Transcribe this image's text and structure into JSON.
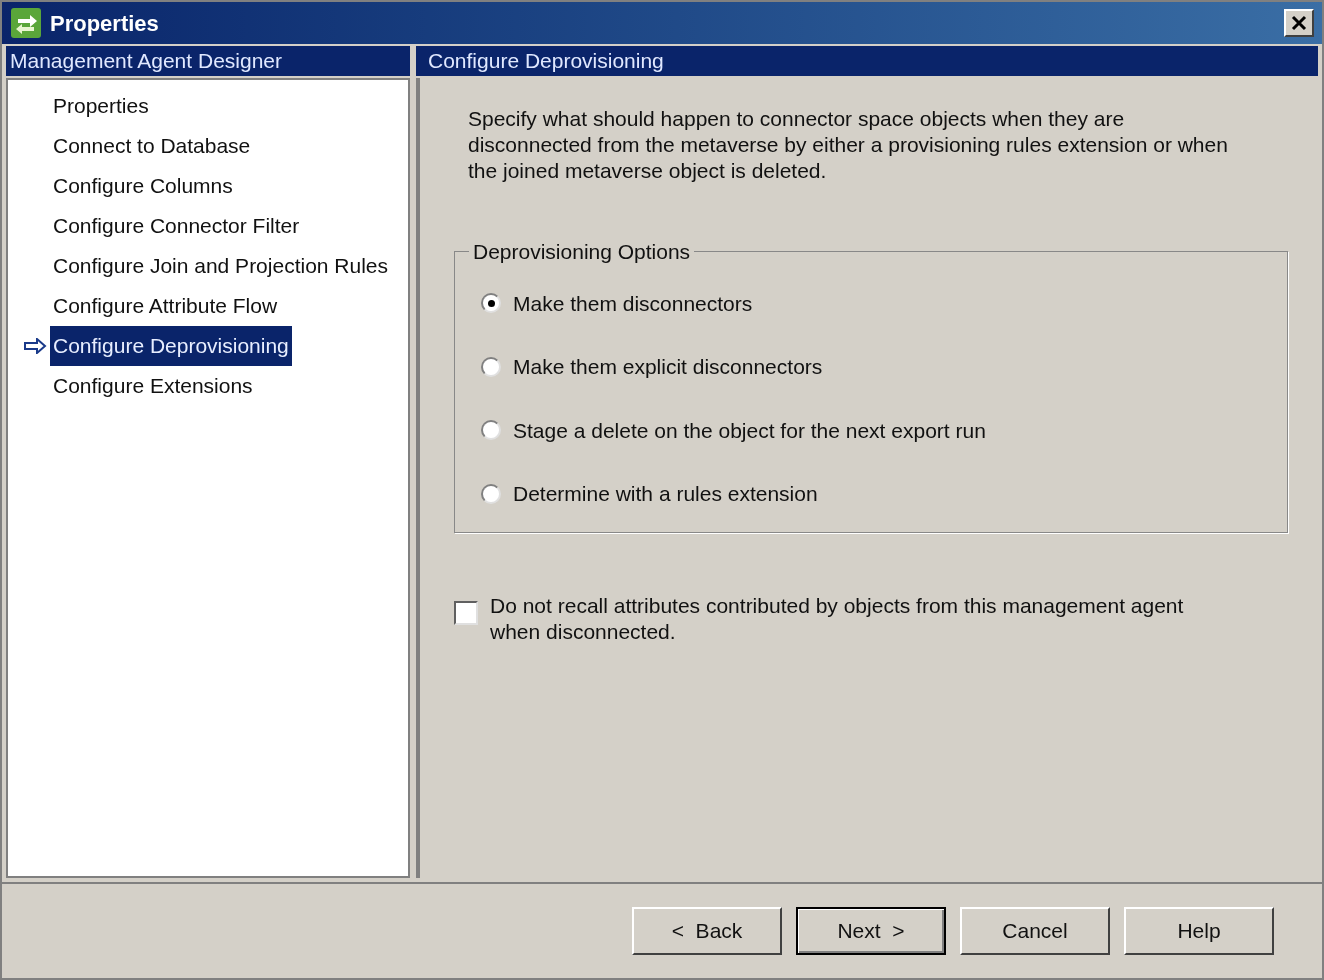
{
  "window": {
    "title": "Properties"
  },
  "sidebar": {
    "title": "Management Agent Designer",
    "items": [
      {
        "label": "Properties",
        "selected": false
      },
      {
        "label": "Connect to Database",
        "selected": false
      },
      {
        "label": "Configure Columns",
        "selected": false
      },
      {
        "label": "Configure Connector Filter",
        "selected": false
      },
      {
        "label": "Configure Join and Projection Rules",
        "selected": false
      },
      {
        "label": "Configure Attribute Flow",
        "selected": false
      },
      {
        "label": "Configure Deprovisioning",
        "selected": true
      },
      {
        "label": "Configure Extensions",
        "selected": false
      }
    ]
  },
  "content": {
    "title": "Configure Deprovisioning",
    "description": "Specify what should happen to connector space objects when they are disconnected from the metaverse by either a provisioning rules extension or when the joined metaverse object is deleted.",
    "group": {
      "title": "Deprovisioning Options",
      "options": [
        {
          "label": "Make them disconnectors",
          "selected": true
        },
        {
          "label": "Make them explicit disconnectors",
          "selected": false
        },
        {
          "label": "Stage a delete on the object for the next export run",
          "selected": false
        },
        {
          "label": "Determine with a rules extension",
          "selected": false
        }
      ]
    },
    "checkbox": {
      "label": "Do not recall attributes contributed by objects from this management agent when disconnected.",
      "checked": false
    }
  },
  "buttons": [
    {
      "label": "<  Back",
      "default": false
    },
    {
      "label": "Next  >",
      "default": true
    },
    {
      "label": "Cancel",
      "default": false
    },
    {
      "label": "Help",
      "default": false
    }
  ]
}
